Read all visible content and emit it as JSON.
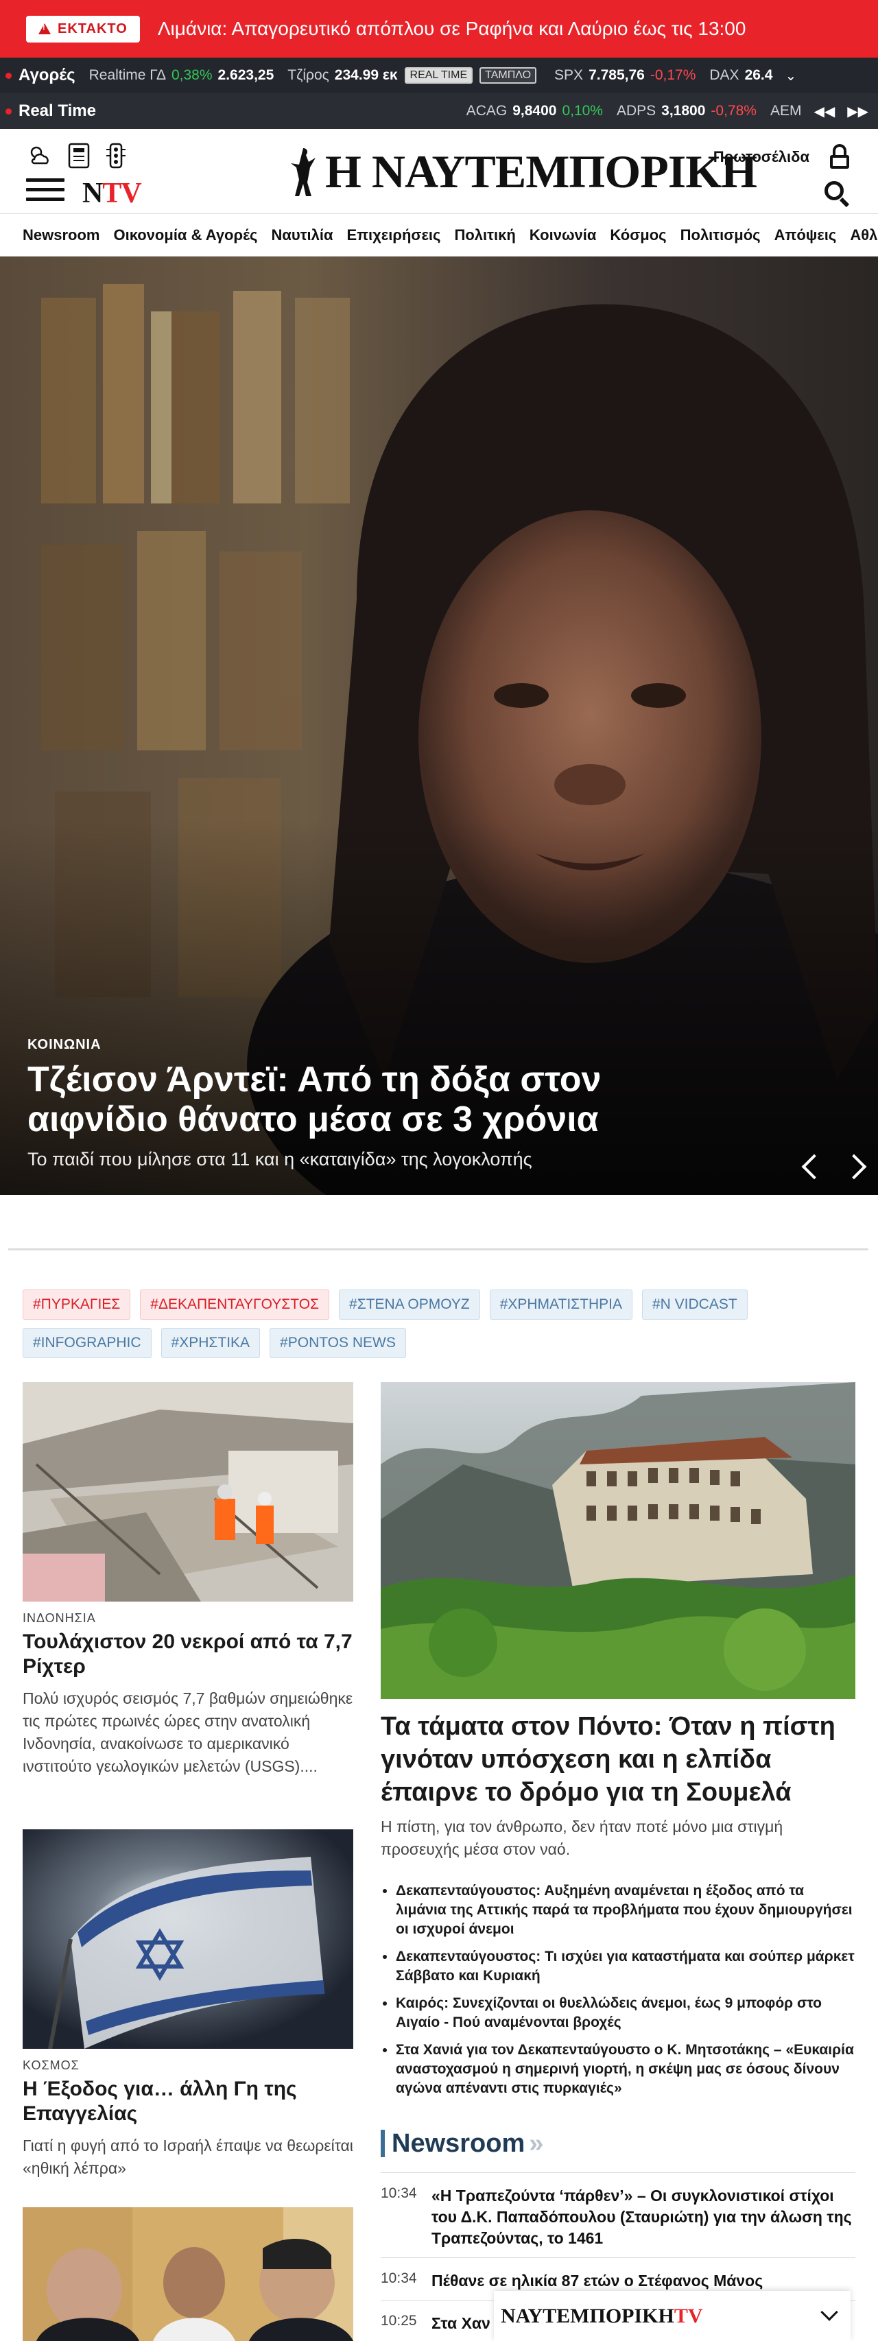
{
  "breaking": {
    "badge": "ΕΚΤΑΚΤΟ",
    "text": "Λιμάνια: Απαγορευτικό απόπλου σε Ραφήνα και Λαύριο έως τις 13:00"
  },
  "ticker1": {
    "label": "Αγορές",
    "items": [
      {
        "name": "Realtime ΓΔ",
        "change": "0,38%",
        "value": "2.623,25",
        "dir": "up"
      },
      {
        "name": "Τζίρος",
        "value": "234.99 εκ"
      }
    ],
    "tags": [
      "REAL TIME",
      "ΤΑΜΠΛΟ"
    ],
    "items2": [
      {
        "name": "SPX",
        "value": "7.785,76",
        "change": "-0,17%",
        "dir": "down"
      },
      {
        "name": "DAX",
        "value": "26.4"
      }
    ]
  },
  "ticker2": {
    "label": "Real Time",
    "items": [
      {
        "name": "ACAG",
        "value": "9,8400",
        "change": "0,10%",
        "dir": "up"
      },
      {
        "name": "ADPS",
        "value": "3,1800",
        "change": "-0,78%",
        "dir": "down"
      },
      {
        "name": "ΑΕΜ",
        "value": ""
      }
    ]
  },
  "header": {
    "logo": "Η ΝΑΥΤΕΜΠΟΡΙΚΗ",
    "ntv_n": "N",
    "ntv_tv": "TV",
    "home_link": "Πρωτοσέλιδα"
  },
  "nav": [
    "Newsroom",
    "Οικονομία & Αγορές",
    "Ναυτιλία",
    "Επιχειρήσεις",
    "Πολιτική",
    "Κοινωνία",
    "Κόσμος",
    "Πολιτισμός",
    "Απόψεις",
    "Αθλ"
  ],
  "hero": {
    "category": "ΚΟΙΝΩΝΙΑ",
    "title": "Τζέισον Άρντεϊ: Από τη δόξα στον αιφνίδιο θάνατο μέσα σε 3 χρόνια",
    "subtitle": "Το παιδί που μίλησε στα 11 και η «καταιγίδα» της λογοκλοπής"
  },
  "tags": [
    {
      "label": "#ΠΥΡΚΑΓΙΕΣ",
      "color": "red"
    },
    {
      "label": "#ΔΕΚΑΠΕΝΤΑΥΓΟΥΣΤΟΣ",
      "color": "red"
    },
    {
      "label": "#ΣΤΕΝΑ ΟΡΜΟΥΖ",
      "color": "blue"
    },
    {
      "label": "#ΧΡΗΜΑΤΙΣΤΗΡΙΑ",
      "color": "blue"
    },
    {
      "label": "#N VIDCAST",
      "color": "blue"
    },
    {
      "label": "#INFOGRAPHIC",
      "color": "blue"
    },
    {
      "label": "#ΧΡΗΣΤΙΚΑ",
      "color": "blue"
    },
    {
      "label": "#PONTOS NEWS",
      "color": "blue"
    }
  ],
  "left_articles": [
    {
      "category": "ΙΝΔΟΝΗΣΙΑ",
      "title": "Τουλάχιστον 20 νεκροί από τα 7,7 Ρίχτερ",
      "desc": "Πολύ ισχυρός σεισμός 7,7 βαθμών σημειώθηκε τις πρώτες πρωινές ώρες στην ανατολική Ινδονησία, ανακοίνωσε το αμερικανικό ινστιτούτο γεωλογικών μελετών (USGS)...."
    },
    {
      "category": "ΚΟΣΜΟΣ",
      "title": "Η Έξοδος για… άλλη Γη της Επαγγελίας",
      "desc": "Γιατί η φυγή από το Ισραήλ έπαψε να θεωρείται «ηθική λέπρα»"
    }
  ],
  "feature": {
    "title": "Τα τάματα στον Πόντο: Όταν η πίστη γινόταν υπόσχεση και η ελπίδα έπαιρνε το δρόμο για τη Σουμελά",
    "desc": "Η πίστη, για τον άνθρωπο, δεν ήταν ποτέ μόνο μια στιγμή προσευχής μέσα στον ναό.",
    "bullets": [
      "Δεκαπενταύγουστος: Αυξημένη αναμένεται η έξοδος από τα λιμάνια της Αττικής παρά τα προβλήματα που έχουν δημιουργήσει οι ισχυροί άνεμοι",
      "Δεκαπενταύγουστος: Τι ισχύει για καταστήματα και σούπερ μάρκετ Σάββατο και Κυριακή",
      "Καιρός: Συνεχίζονται οι θυελλώδεις άνεμοι, έως 9 μποφόρ στο Αιγαίο - Πού αναμένονται βροχές",
      "Στα Χανιά για τον Δεκαπενταύγουστο ο Κ. Μητσοτάκης – «Ευκαιρία αναστοχασμού η σημερινή γιορτή, η σκέψη μας σε όσους δίνουν αγώνα απέναντι στις πυρκαγιές»"
    ]
  },
  "newsroom": {
    "heading": "Newsroom",
    "arrows": "»",
    "items": [
      {
        "time": "10:34",
        "text": "«Η Τραπεζούντα ‘πάρθεν’» – Οι συγκλονιστικοί στίχοι του Δ.Κ. Παπαδόπουλου (Σταυριώτη) για την άλωση της Τραπεζούντας, το 1461"
      },
      {
        "time": "10:34",
        "text": "Πέθανε σε ηλικία 87 ετών ο Στέφανος Μάνος"
      },
      {
        "time": "10:25",
        "text": "Στα Χαν"
      }
    ]
  },
  "ntv_bar": {
    "logo_main": "ΝΑΥΤΕΜΠΟΡΙΚΗ",
    "logo_tv": "TV"
  },
  "colors": {
    "accent": "#e8232a",
    "ticker_bg": "#23262c",
    "tag_blue": "#4a78a2",
    "up": "#34c759",
    "down": "#ff4a4f"
  }
}
